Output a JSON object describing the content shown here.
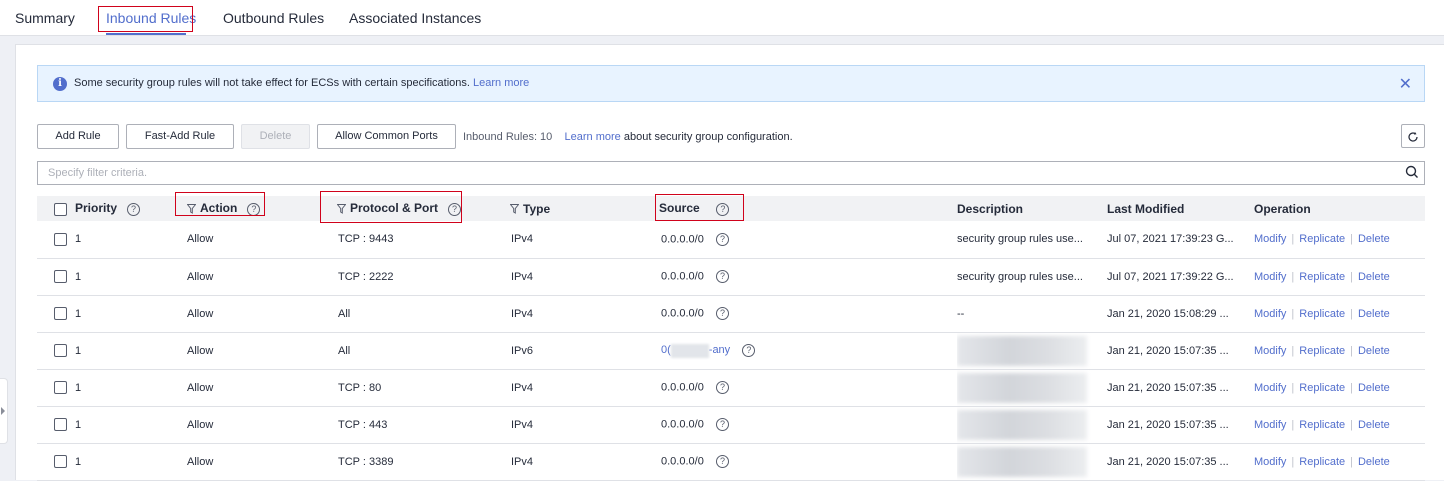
{
  "tabs": [
    "Summary",
    "Inbound Rules",
    "Outbound Rules",
    "Associated Instances"
  ],
  "notice": {
    "message": "Some security group rules will not take effect for ECSs with certain specifications.",
    "link": "Learn more"
  },
  "toolbar": {
    "add_rule": "Add Rule",
    "fast_add_rule": "Fast-Add Rule",
    "delete": "Delete",
    "allow_common_ports": "Allow Common Ports",
    "rules_count": "Inbound Rules: 10",
    "learn_more": "Learn more",
    "about_text": "about security group configuration."
  },
  "filter": {
    "placeholder": "Specify filter criteria."
  },
  "columns": {
    "priority": "Priority",
    "action": "Action",
    "protocol_port": "Protocol & Port",
    "type": "Type",
    "source": "Source",
    "description": "Description",
    "last_modified": "Last Modified",
    "operation": "Operation"
  },
  "operations": {
    "modify": "Modify",
    "replicate": "Replicate",
    "delete": "Delete"
  },
  "rows": [
    {
      "priority": "1",
      "action": "Allow",
      "protocol_port": "TCP : 9443",
      "type": "IPv4",
      "source": "0.0.0.0/0",
      "description": "security group rules use...",
      "last_modified": "Jul 07, 2021 17:39:23 G..."
    },
    {
      "priority": "1",
      "action": "Allow",
      "protocol_port": "TCP : 2222",
      "type": "IPv4",
      "source": "0.0.0.0/0",
      "description": "security group rules use...",
      "last_modified": "Jul 07, 2021 17:39:22 G..."
    },
    {
      "priority": "1",
      "action": "Allow",
      "protocol_port": "All",
      "type": "IPv4",
      "source": "0.0.0.0/0",
      "description": "--",
      "last_modified": "Jan 21, 2020 15:08:29 ..."
    },
    {
      "priority": "1",
      "action": "Allow",
      "protocol_port": "All",
      "type": "IPv6",
      "source_prefix": "0(",
      "source_suffix": "-any",
      "description": "",
      "last_modified": "Jan 21, 2020 15:07:35 ..."
    },
    {
      "priority": "1",
      "action": "Allow",
      "protocol_port": "TCP : 80",
      "type": "IPv4",
      "source": "0.0.0.0/0",
      "description": "",
      "last_modified": "Jan 21, 2020 15:07:35 ..."
    },
    {
      "priority": "1",
      "action": "Allow",
      "protocol_port": "TCP : 443",
      "type": "IPv4",
      "source": "0.0.0.0/0",
      "description": "",
      "last_modified": "Jan 21, 2020 15:07:35 ..."
    },
    {
      "priority": "1",
      "action": "Allow",
      "protocol_port": "TCP : 3389",
      "type": "IPv4",
      "source": "0.0.0.0/0",
      "description": "",
      "last_modified": "Jan 21, 2020 15:07:35 ..."
    }
  ],
  "colors": {
    "accent": "#526ecc",
    "highlight_box": "#d0021b"
  }
}
